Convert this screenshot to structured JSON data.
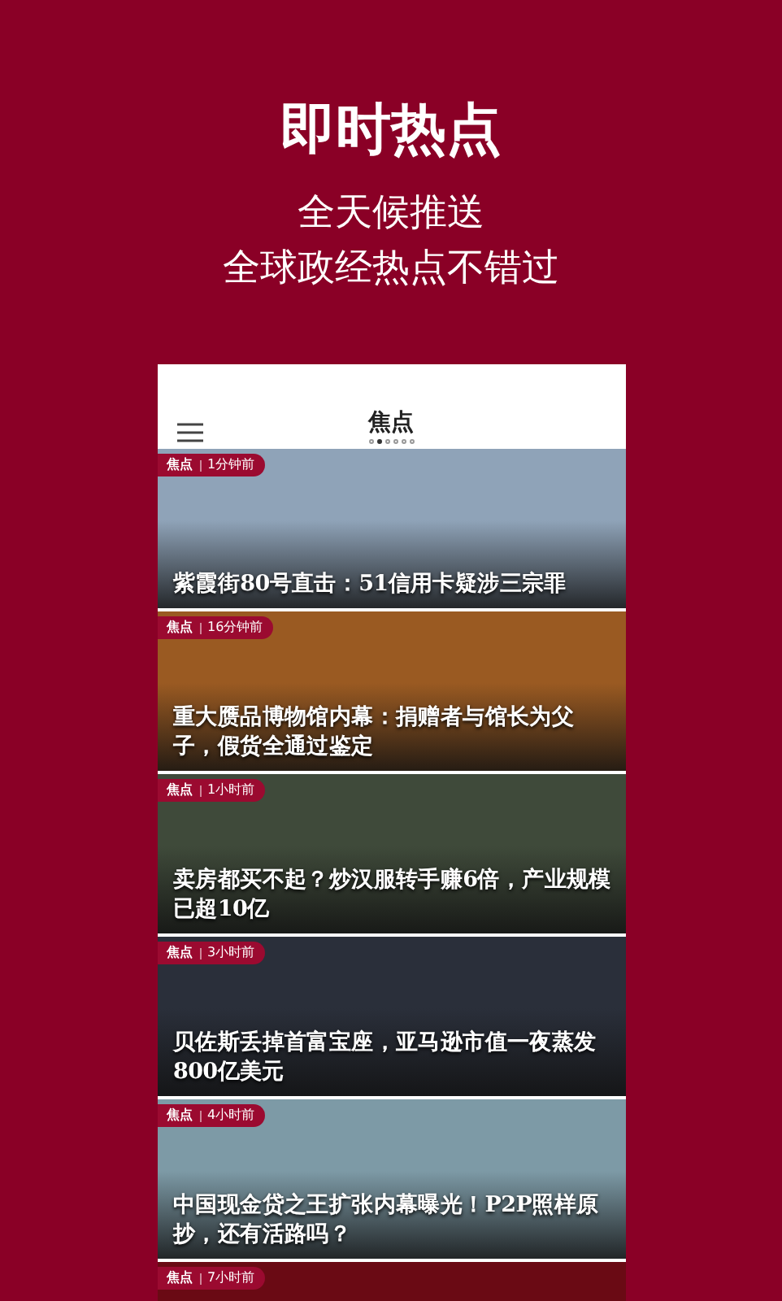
{
  "promo": {
    "headline": "即时热点",
    "lines": [
      "全天候推送",
      "全球政经热点不错过"
    ]
  },
  "app": {
    "title": "焦点",
    "pages": [
      {
        "selected": false
      },
      {
        "selected": true
      },
      {
        "selected": false
      },
      {
        "selected": false
      },
      {
        "selected": false
      },
      {
        "selected": false
      }
    ],
    "articles": [
      {
        "tag": "焦点",
        "time": "1分钟前",
        "title": "紫霞街80号直击：51信用卡疑涉三宗罪",
        "color": "#8fa3b8"
      },
      {
        "tag": "焦点",
        "time": "16分钟前",
        "title": "重大赝品博物馆内幕：捐赠者与馆长为父子，假货全通过鉴定",
        "color": "#9a5a22"
      },
      {
        "tag": "焦点",
        "time": "1小时前",
        "title": "卖房都买不起？炒汉服转手赚6倍，产业规模已超10亿",
        "color": "#3f4a3a"
      },
      {
        "tag": "焦点",
        "time": "3小时前",
        "title": "贝佐斯丢掉首富宝座，亚马逊市值一夜蒸发800亿美元",
        "color": "#2a2f3a"
      },
      {
        "tag": "焦点",
        "time": "4小时前",
        "title": "中国现金贷之王扩张内幕曝光！P2P照样原抄，还有活路吗？",
        "color": "#7d9aa6"
      },
      {
        "tag": "焦点",
        "time": "7小时前",
        "color": "#6a0a14"
      }
    ]
  }
}
